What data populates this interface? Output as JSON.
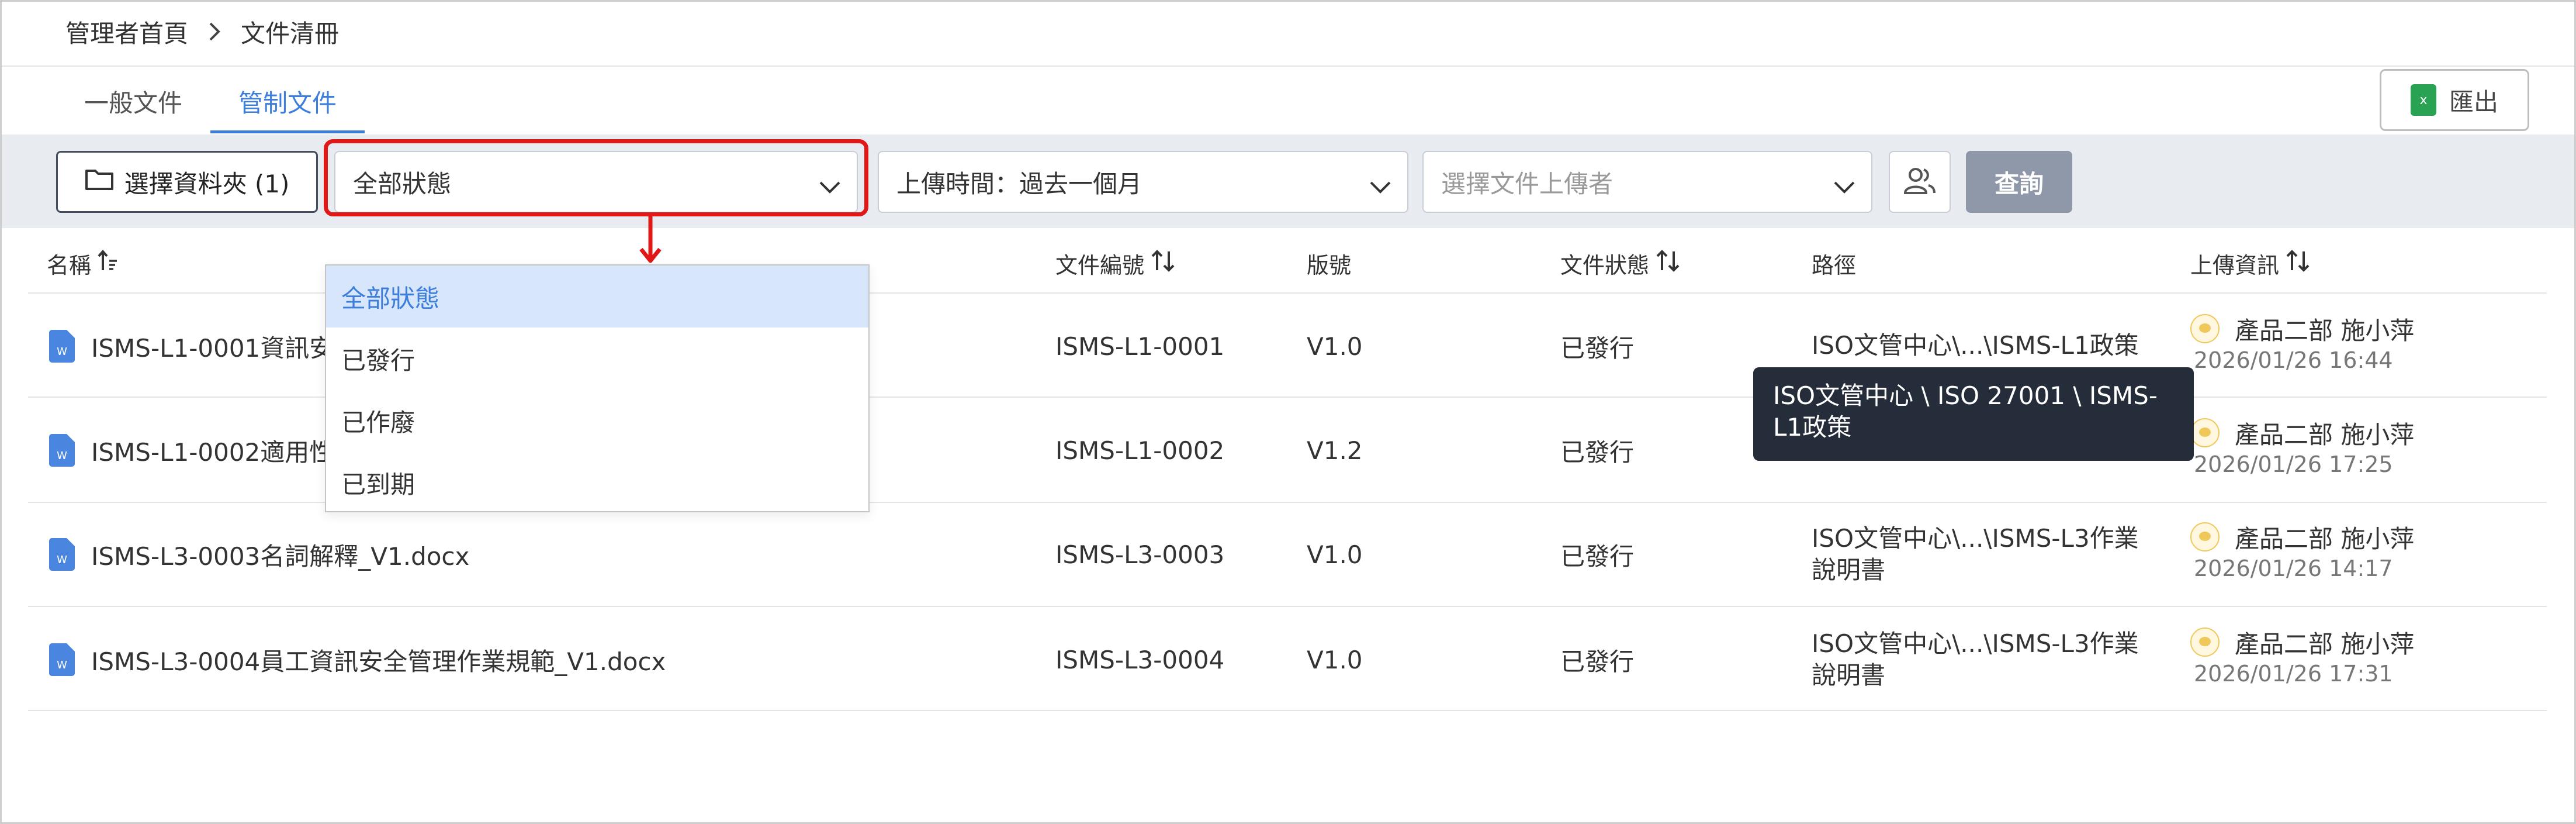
{
  "breadcrumb": {
    "home": "管理者首頁",
    "current": "文件清冊"
  },
  "tabs": [
    {
      "label": "一般文件",
      "active": false
    },
    {
      "label": "管制文件",
      "active": true
    }
  ],
  "export": {
    "label": "匯出",
    "icon": "excel-icon",
    "icon_text": "x"
  },
  "filters": {
    "folder_button": "選擇資料夾 (1)",
    "status_select": "全部狀態",
    "upload_time_select": "上傳時間：過去一個月",
    "uploader_placeholder": "選擇文件上傳者",
    "query_button": "查詢"
  },
  "status_options": [
    {
      "label": "全部狀態",
      "selected": true
    },
    {
      "label": "已發行",
      "selected": false
    },
    {
      "label": "已作廢",
      "selected": false
    },
    {
      "label": "已到期",
      "selected": false
    }
  ],
  "table": {
    "columns": {
      "name": "名稱",
      "code": "文件編號",
      "version": "版號",
      "status": "文件狀態",
      "path": "路徑",
      "upload": "上傳資訊"
    },
    "doc_icon_text": "W",
    "rows": [
      {
        "name": "ISMS-L1-0001資訊安",
        "code": "ISMS-L1-0001",
        "version": "V1.0",
        "status": "已發行",
        "path": "ISO文管中心\\...\\ISMS-L1政策",
        "uploader": "產品二部 施小萍",
        "time": "2026/01/26 16:44"
      },
      {
        "name": "ISMS-L1-0002適用性",
        "code": "ISMS-L1-0002",
        "version": "V1.2",
        "status": "已發行",
        "path": "",
        "uploader": "產品二部 施小萍",
        "time": "2026/01/26 17:25"
      },
      {
        "name": "ISMS-L3-0003名詞解釋_V1.docx",
        "code": "ISMS-L3-0003",
        "version": "V1.0",
        "status": "已發行",
        "path": "ISO文管中心\\...\\ISMS-L3作業說明書",
        "uploader": "產品二部 施小萍",
        "time": "2026/01/26 14:17"
      },
      {
        "name": "ISMS-L3-0004員工資訊安全管理作業規範_V1.docx",
        "code": "ISMS-L3-0004",
        "version": "V1.0",
        "status": "已發行",
        "path": "ISO文管中心\\...\\ISMS-L3作業說明書",
        "uploader": "產品二部 施小萍",
        "time": "2026/01/26 17:31"
      }
    ]
  },
  "tooltip": {
    "text": "ISO文管中心 \\ ISO 27001 \\ ISMS-L1政策"
  },
  "colors": {
    "accent": "#3d7edb",
    "highlight": "#e01818",
    "tooltip_bg": "#252c3a",
    "query_button": "#8e98a8"
  }
}
